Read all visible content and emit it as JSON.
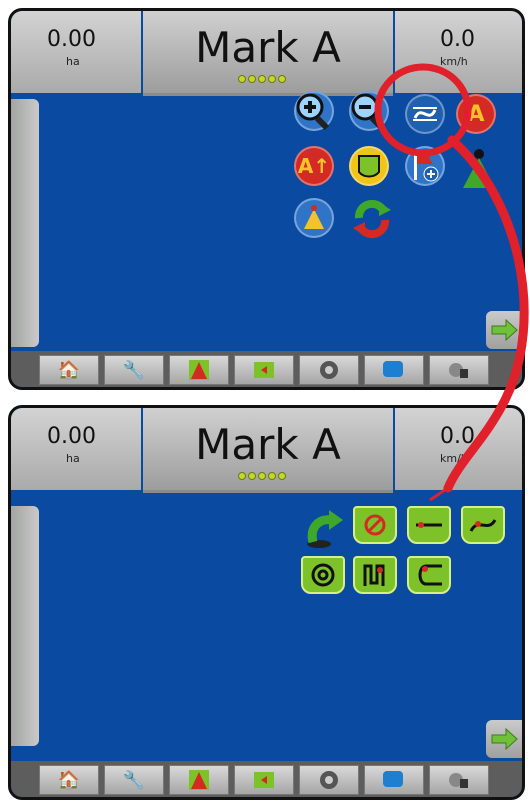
{
  "screens": [
    {
      "area": {
        "value": "0.00",
        "unit": "ha"
      },
      "title": "Mark A",
      "speed": {
        "value": "0.0",
        "unit": "km/h"
      }
    },
    {
      "area": {
        "value": "0.00",
        "unit": "ha"
      },
      "title": "Mark A",
      "speed": {
        "value": "0.0",
        "unit": "km/h"
      }
    }
  ],
  "icons": {
    "screen1": [
      "zoom-in-icon",
      "zoom-out-icon",
      "guidance-mode-icon",
      "mark-a-icon",
      "a-plus-nudge-icon",
      "boundary-icon",
      "add-marker-icon",
      "vehicle-icon",
      "reset-icon"
    ],
    "screen2": [
      "back-arrow-icon",
      "no-guidance-icon",
      "straight-ab-icon",
      "curved-ab-icon",
      "circle-pivot-icon",
      "last-pass-icon",
      "adaptive-curve-icon"
    ]
  },
  "bottom_icons": [
    "home-icon",
    "tools-icon",
    "vehicle-view-icon",
    "field-view-icon",
    "camera-icon",
    "data-icon",
    "settings-lock-icon"
  ],
  "colors": {
    "screen_bg": "#0a4aa0",
    "green_button": "#7ec22a",
    "callout": "#e0202a",
    "accent_dots": "#c4d82a"
  }
}
